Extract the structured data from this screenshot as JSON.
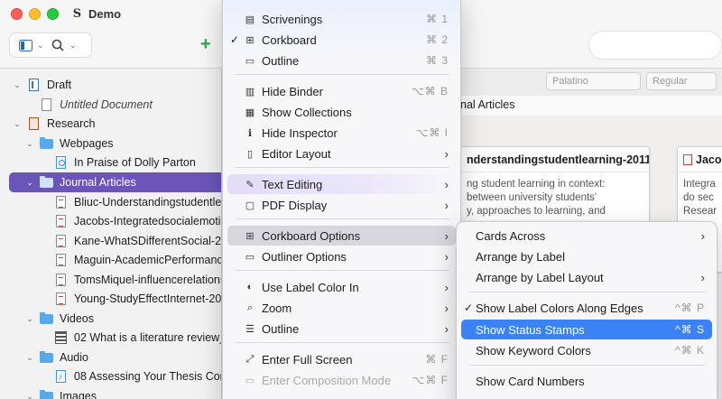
{
  "window": {
    "title": "Demo"
  },
  "binder": {
    "items": [
      {
        "label": "Draft",
        "level": 0,
        "icon": "draft-icon",
        "disclosure": "open"
      },
      {
        "label": "Untitled Document",
        "level": 1,
        "icon": "document-icon",
        "italic": true
      },
      {
        "label": "Research",
        "level": 0,
        "icon": "research-icon",
        "disclosure": "open"
      },
      {
        "label": "Webpages",
        "level": 1,
        "icon": "folder-icon",
        "disclosure": "open"
      },
      {
        "label": "In Praise of Dolly Parton",
        "level": 2,
        "icon": "webpage-icon"
      },
      {
        "label": "Journal Articles",
        "level": 1,
        "icon": "folder-icon",
        "disclosure": "open",
        "selected": true
      },
      {
        "label": "Bliuc-Understandingstudentle",
        "level": 2,
        "icon": "pdf-icon"
      },
      {
        "label": "Jacobs-Integratedsocialemoti",
        "level": 2,
        "icon": "pdf-icon"
      },
      {
        "label": "Kane-WhatSDifferentSocial-20",
        "level": 2,
        "icon": "pdf-icon"
      },
      {
        "label": "Maguin-AcademicPerformance",
        "level": 2,
        "icon": "pdf-icon"
      },
      {
        "label": "TomsMiquel-influencerelations",
        "level": 2,
        "icon": "pdf-icon"
      },
      {
        "label": "Young-StudyEffectInternet-20",
        "level": 2,
        "icon": "pdf-icon"
      },
      {
        "label": "Videos",
        "level": 1,
        "icon": "folder-icon",
        "disclosure": "open"
      },
      {
        "label": "02 What is a literature review_",
        "level": 2,
        "icon": "film-icon"
      },
      {
        "label": "Audio",
        "level": 1,
        "icon": "folder-icon",
        "disclosure": "open"
      },
      {
        "label": "08 Assessing Your Thesis Con",
        "level": 2,
        "icon": "audio-icon"
      },
      {
        "label": "Images",
        "level": 1,
        "icon": "folder-icon",
        "disclosure": "open"
      }
    ]
  },
  "format_bar": {
    "font": "Palatino",
    "style": "Regular"
  },
  "editor": {
    "header": "nal Articles",
    "cards": [
      {
        "title": "nderstandingstudentlearning-2011",
        "body": [
          "ng student learning in context:",
          " between university students'",
          "y, approaches to learning, and"
        ]
      },
      {
        "title": "Jaco",
        "body": [
          "Integra",
          "do sec",
          "Resear"
        ]
      }
    ]
  },
  "view_menu": {
    "items": [
      {
        "label": "Scrivenings",
        "icon": "scrivenings-icon",
        "shortcut": "⌘ 1"
      },
      {
        "label": "Corkboard",
        "icon": "corkboard-icon",
        "shortcut": "⌘ 2",
        "checked": true
      },
      {
        "label": "Outline",
        "icon": "outline-icon",
        "shortcut": "⌘ 3"
      },
      {
        "label": "Hide Binder",
        "icon": "binder-icon",
        "shortcut": "⌥⌘ B"
      },
      {
        "label": "Show Collections",
        "icon": "collections-icon"
      },
      {
        "label": "Hide Inspector",
        "icon": "info-icon",
        "shortcut": "⌥⌘ I"
      },
      {
        "label": "Editor Layout",
        "icon": "layout-icon",
        "submenu": true
      },
      {
        "label": "Text Editing",
        "icon": "text-editing-icon",
        "submenu": true
      },
      {
        "label": "PDF Display",
        "icon": "pdf-display-icon",
        "submenu": true
      },
      {
        "label": "Corkboard Options",
        "icon": "corkboard-icon",
        "submenu": true
      },
      {
        "label": "Outliner Options",
        "icon": "outliner-icon",
        "submenu": true
      },
      {
        "label": "Use Label Color In",
        "icon": "label-color-icon",
        "submenu": true
      },
      {
        "label": "Zoom",
        "icon": "zoom-icon",
        "submenu": true
      },
      {
        "label": "Outline",
        "icon": "outline-list-icon",
        "submenu": true
      },
      {
        "label": "Enter Full Screen",
        "icon": "fullscreen-icon",
        "shortcut": "⌘ F"
      },
      {
        "label": "Enter Composition Mode",
        "icon": "composition-icon",
        "shortcut": "⌥⌘ F"
      }
    ]
  },
  "corkboard_submenu": {
    "items": [
      {
        "label": "Cards Across",
        "submenu": true
      },
      {
        "label": "Arrange by Label"
      },
      {
        "label": "Arrange by Label Layout",
        "submenu": true
      },
      {
        "label": "Show Label Colors Along Edges",
        "checked": true,
        "shortcut": "^⌘ P"
      },
      {
        "label": "Show Status Stamps",
        "shortcut": "^⌘ S"
      },
      {
        "label": "Show Keyword Colors",
        "shortcut": "^⌘ K"
      },
      {
        "label": "Show Card Numbers"
      }
    ]
  },
  "colors": {
    "selection": "#6a56b8",
    "menu_highlight": "#3b82f6",
    "accent_green": "#2ba84a"
  }
}
